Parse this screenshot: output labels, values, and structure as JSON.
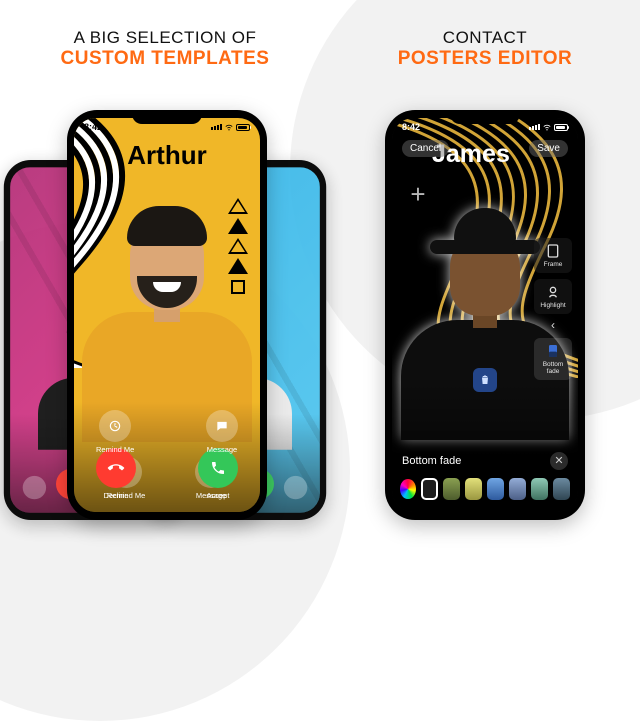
{
  "accent_color": "#ff6a13",
  "left": {
    "headline_top": "A BIG SELECTION OF",
    "headline_accent": "CUSTOM TEMPLATES",
    "center_phone": {
      "time": "8:42",
      "name": "Arthur",
      "call_actions": {
        "remind": "Remind Me",
        "message": "Message",
        "decline": "Decline",
        "accept": "Accept"
      }
    },
    "back_left": {
      "decline": "Decline",
      "accept": "Accept"
    },
    "back_right": {
      "decline": "Decline",
      "accept": "Accept"
    }
  },
  "right": {
    "headline_top": "CONTACT",
    "headline_accent": "POSTERS EDITOR",
    "phone": {
      "time": "8:42",
      "cancel": "Cancel",
      "save": "Save",
      "name": "James",
      "side_tools": {
        "frame": "Frame",
        "highlight": "Highlight",
        "bottom_fade": "Bottom\nfade"
      },
      "effect_label": "Bottom fade",
      "swatches": [
        "#1d1d1d",
        "#7b8c4a",
        "#c9c96a",
        "#5a8ccf",
        "#7d96c4",
        "#7fb6a7",
        "#5e7c8c"
      ]
    }
  }
}
